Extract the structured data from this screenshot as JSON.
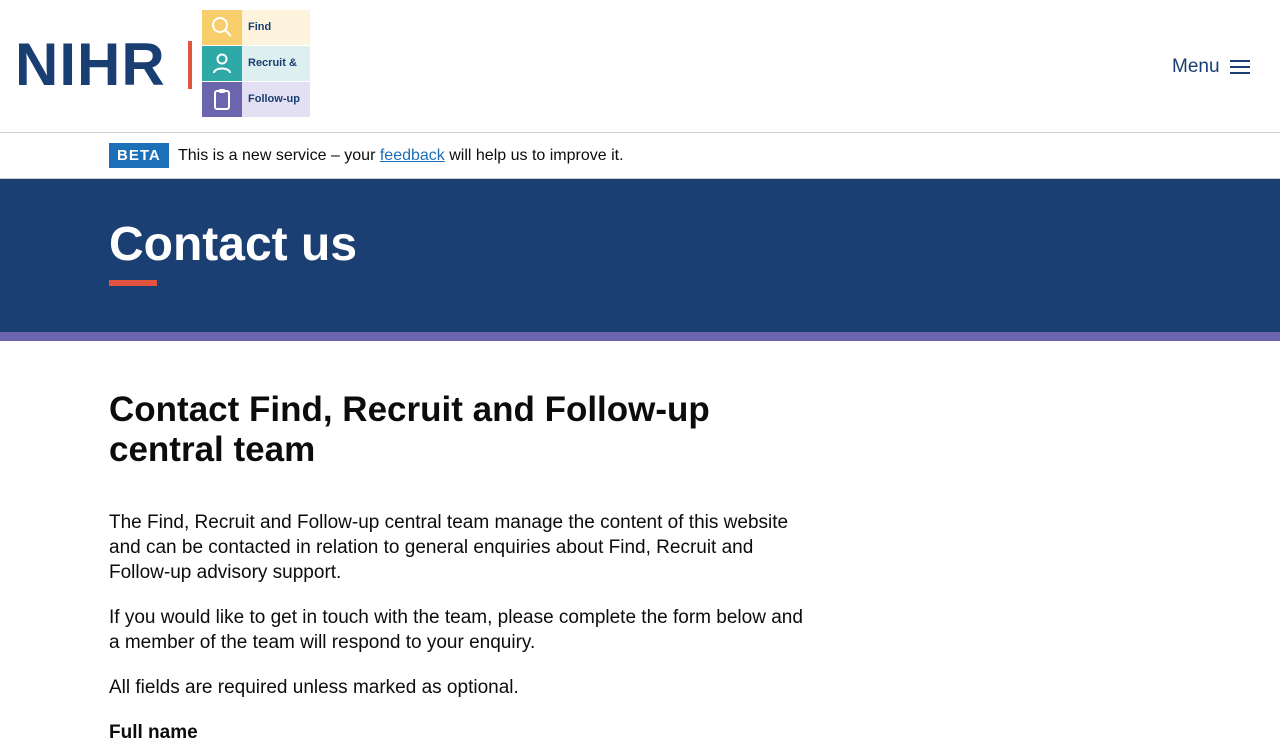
{
  "header": {
    "logo_text": "NIHR",
    "service_logo": {
      "rows": [
        {
          "label": "Find",
          "icon": "search-icon",
          "icon_bg": "#f8cd6b",
          "text_bg": "#fef3dc"
        },
        {
          "label": "Recruit &",
          "icon": "person-icon",
          "icon_bg": "#2fa9a7",
          "text_bg": "#ddefef"
        },
        {
          "label": "Follow-up",
          "icon": "clipboard-icon",
          "icon_bg": "#6a65ad",
          "text_bg": "#e2e0f2"
        }
      ]
    },
    "menu_label": "Menu"
  },
  "beta_banner": {
    "tag": "BETA",
    "text_before": "This is a new service – your ",
    "link": "feedback",
    "text_after": " will help us to improve it."
  },
  "hero": {
    "title": "Contact us"
  },
  "main": {
    "heading": "Contact Find, Recruit and Follow-up central team",
    "paragraphs": [
      "The Find, Recruit and Follow-up central team manage the content of this website and can be contacted in relation to general enquiries about Find, Recruit and Follow-up advisory support.",
      "If you would like to get in touch with the team, please complete the form below and a member of the team will respond to your enquiry.",
      "All fields are required unless marked as optional."
    ],
    "first_field_label": "Full name"
  },
  "colors": {
    "brand_navy": "#1b3f72",
    "accent_red": "#e1553f",
    "stripe_purple": "#6a65ad",
    "link_blue": "#1d70b8"
  }
}
